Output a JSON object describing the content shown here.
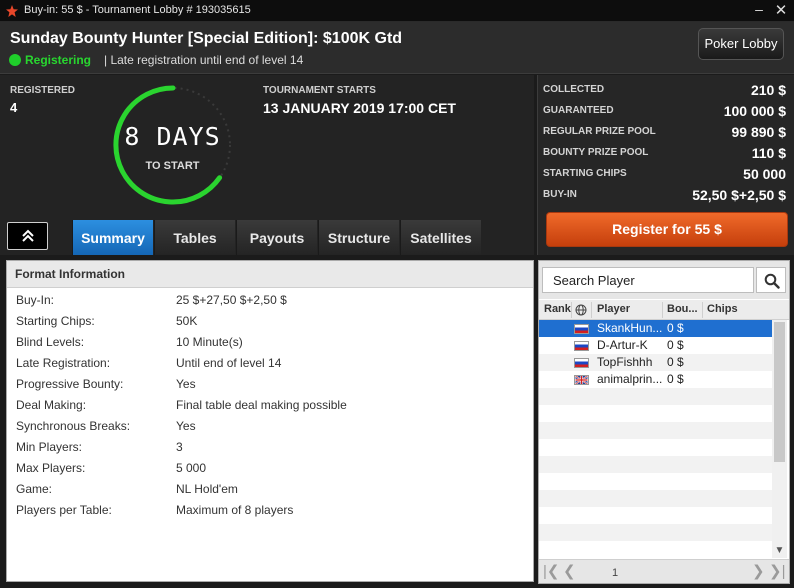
{
  "window": {
    "title": "Buy-in: 55 $ - Tournament Lobby # 193035615",
    "minimize": "–",
    "close": "✕",
    "logo_icon": "pokerstars-star-icon",
    "logo_color": "#e8472a"
  },
  "header": {
    "tournament_name": "Sunday Bounty Hunter [Special Edition]: $100K Gtd",
    "status": "Registering",
    "late_reg": "| Late registration until end of level 14",
    "status_color": "#1fce2a",
    "poker_lobby_label": "Poker Lobby"
  },
  "stats": {
    "registered_label": "REGISTERED",
    "registered_value": "4",
    "countdown": "8 DAYS",
    "countdown_sub": "TO START",
    "starts_label": "TOURNAMENT STARTS",
    "starts_value": "13 JANUARY 2019  17:00 CET"
  },
  "tabs": [
    {
      "label": "Summary",
      "active": true
    },
    {
      "label": "Tables",
      "active": false
    },
    {
      "label": "Payouts",
      "active": false
    },
    {
      "label": "Structure",
      "active": false
    },
    {
      "label": "Satellites",
      "active": false
    }
  ],
  "prize": {
    "rows": [
      {
        "label": "COLLECTED",
        "value": "210 $"
      },
      {
        "label": "GUARANTEED",
        "value": "100 000 $"
      },
      {
        "label": "REGULAR PRIZE POOL",
        "value": "99 890 $"
      },
      {
        "label": "BOUNTY PRIZE POOL",
        "value": "110 $"
      },
      {
        "label": "STARTING CHIPS",
        "value": "50 000"
      },
      {
        "label": "BUY-IN",
        "value": "52,50 $+2,50 $"
      }
    ],
    "register_label": "Register for   55 $",
    "register_color": "#e85a1c"
  },
  "format": {
    "title": "Format Information",
    "rows": [
      {
        "label": "Buy-In:",
        "value": "25 $+27,50 $+2,50 $"
      },
      {
        "label": "Starting Chips:",
        "value": "50K"
      },
      {
        "label": "Blind Levels:",
        "value": "10 Minute(s)"
      },
      {
        "label": "Late Registration:",
        "value": "Until end of level 14"
      },
      {
        "label": "Progressive Bounty:",
        "value": "Yes"
      },
      {
        "label": "Deal Making:",
        "value": "Final table deal making possible"
      },
      {
        "label": "Synchronous Breaks:",
        "value": "Yes"
      },
      {
        "label": "Min Players:",
        "value": "3"
      },
      {
        "label": "Max Players:",
        "value": "5 000"
      },
      {
        "label": "Game:",
        "value": "NL Hold'em"
      },
      {
        "label": "Players per Table:",
        "value": "Maximum of 8 players"
      }
    ]
  },
  "players": {
    "search_placeholder": "Search Player",
    "columns": {
      "rank": "Rank",
      "player": "Player",
      "bounty": "Bou...",
      "chips": "Chips"
    },
    "rows": [
      {
        "name": "SkankHun...",
        "bounty": "0 $",
        "flag": "russia",
        "selected": true
      },
      {
        "name": "D-Artur-K",
        "bounty": "0 $",
        "flag": "russia",
        "selected": false
      },
      {
        "name": "TopFishhh",
        "bounty": "0 $",
        "flag": "russia",
        "selected": false
      },
      {
        "name": "animalprin...",
        "bounty": "0 $",
        "flag": "united-kingdom",
        "selected": false
      }
    ],
    "page": "1"
  }
}
